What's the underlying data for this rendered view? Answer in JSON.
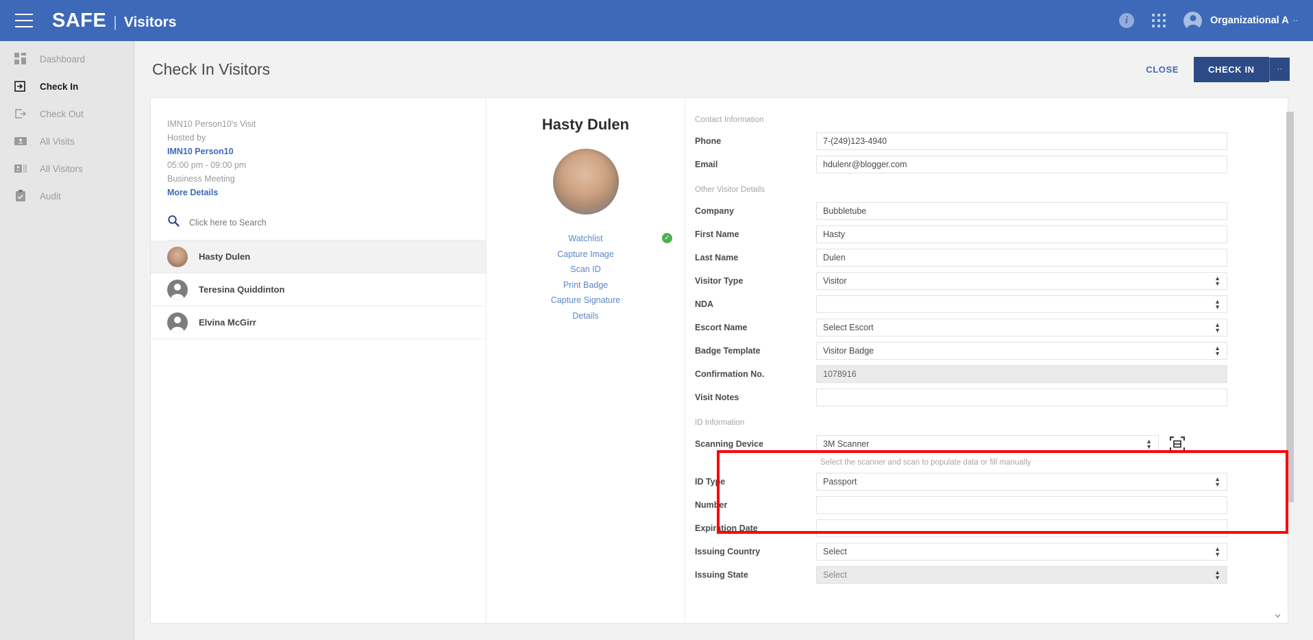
{
  "topbar": {
    "menu_icon": "hamburger-icon",
    "brand": "SAFE",
    "separator": "|",
    "app_name": "Visitors",
    "info_icon": "info-icon",
    "apps_icon": "apps-grid-icon",
    "avatar_icon": "user-avatar-icon",
    "org_name": "Organizational A",
    "org_caret": "··"
  },
  "sidebar": {
    "items": [
      {
        "label": "Dashboard",
        "icon": "dashboard-icon",
        "active": false
      },
      {
        "label": "Check In",
        "icon": "check-in-icon",
        "active": true
      },
      {
        "label": "Check Out",
        "icon": "check-out-icon",
        "active": false
      },
      {
        "label": "All Visits",
        "icon": "all-visits-icon",
        "active": false
      },
      {
        "label": "All Visitors",
        "icon": "all-visitors-icon",
        "active": false
      },
      {
        "label": "Audit",
        "icon": "audit-clipboard-icon",
        "active": false
      }
    ]
  },
  "page": {
    "title": "Check In Visitors",
    "close_label": "CLOSE",
    "checkin_label": "CHECK IN",
    "checkin_caret": "··"
  },
  "visit": {
    "title": "IMN10 Person10's Visit",
    "hosted_by_label": "Hosted by",
    "host": "IMN10 Person10",
    "time": "05:00 pm - 09:00 pm",
    "purpose": "Business Meeting",
    "more_details": "More Details"
  },
  "search": {
    "icon": "search-icon",
    "placeholder": "Click here to Search"
  },
  "visitor_list": [
    {
      "name": "Hasty Dulen",
      "selected": true,
      "avatar": "photo-avatar"
    },
    {
      "name": "Teresina Quiddinton",
      "selected": false,
      "avatar": "person-avatar"
    },
    {
      "name": "Elvina McGirr",
      "selected": false,
      "avatar": "person-avatar"
    }
  ],
  "visitor_detail": {
    "name": "Hasty Dulen",
    "photo": "visitor-photo",
    "actions": [
      {
        "label": "Watchlist",
        "badge": "✓"
      },
      {
        "label": "Capture Image",
        "badge": ""
      },
      {
        "label": "Scan ID",
        "badge": ""
      },
      {
        "label": "Print Badge",
        "badge": ""
      },
      {
        "label": "Capture Signature",
        "badge": ""
      },
      {
        "label": "Details",
        "badge": ""
      }
    ]
  },
  "form": {
    "contact_section": "Contact Information",
    "phone_label": "Phone",
    "phone_value": "7-(249)123-4940",
    "email_label": "Email",
    "email_value": "hdulenr@blogger.com",
    "other_section": "Other Visitor Details",
    "company_label": "Company",
    "company_value": "Bubbletube",
    "first_name_label": "First Name",
    "first_name_value": "Hasty",
    "last_name_label": "Last Name",
    "last_name_value": "Dulen",
    "visitor_type_label": "Visitor Type",
    "visitor_type_value": "Visitor",
    "nda_label": "NDA",
    "nda_value": "",
    "escort_name_label": "Escort Name",
    "escort_name_value": "Select Escort",
    "badge_template_label": "Badge Template",
    "badge_template_value": "Visitor Badge",
    "confirmation_label": "Confirmation No.",
    "confirmation_value": "1078916",
    "visit_notes_label": "Visit Notes",
    "visit_notes_value": "",
    "id_section": "ID Information",
    "scanning_device_label": "Scanning Device",
    "scanning_device_value": "3M Scanner",
    "scan_button_icon": "scan-frame-icon",
    "scanner_helper": "Select the scanner and scan to populate data or fill manually",
    "id_type_label": "ID Type",
    "id_type_value": "Passport",
    "number_label": "Number",
    "number_value": "",
    "expiration_label": "Expiration Date",
    "expiration_value": "",
    "issuing_country_label": "Issuing Country",
    "issuing_country_value": "Select",
    "issuing_state_label": "Issuing State",
    "issuing_state_value": "Select"
  },
  "misc": {
    "scroll_chevron": "⌄",
    "highlight_color": "#fb0007",
    "accent_color": "#3d69b8",
    "button_color": "#2c4b86"
  }
}
